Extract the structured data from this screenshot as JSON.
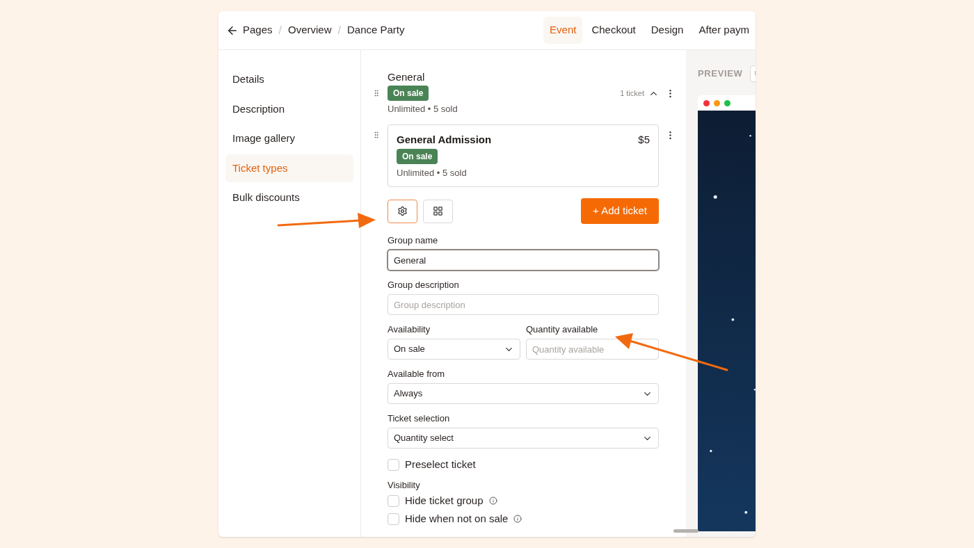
{
  "breadcrumb": {
    "items": [
      "Pages",
      "Overview",
      "Dance Party"
    ],
    "separator": "/"
  },
  "tabs": [
    {
      "label": "Event",
      "selected": true
    },
    {
      "label": "Checkout",
      "selected": false
    },
    {
      "label": "Design",
      "selected": false
    },
    {
      "label": "After paym",
      "selected": false
    }
  ],
  "sidebar": {
    "items": [
      {
        "label": "Details",
        "selected": false
      },
      {
        "label": "Description",
        "selected": false
      },
      {
        "label": "Image gallery",
        "selected": false
      },
      {
        "label": "Ticket types",
        "selected": true
      },
      {
        "label": "Bulk discounts",
        "selected": false
      }
    ]
  },
  "group": {
    "name": "General",
    "status": "On sale",
    "summary": "Unlimited • 5 sold",
    "count": "1 ticket",
    "expanded": true
  },
  "ticket": {
    "name": "General Admission",
    "price": "$5",
    "status": "On sale",
    "summary": "Unlimited • 5 sold"
  },
  "tool_buttons": [
    {
      "kind": "settings",
      "selected": true
    },
    {
      "kind": "grid",
      "selected": false
    }
  ],
  "add_button": "+ Add ticket",
  "form": {
    "rows": [
      [
        {
          "kind": "input",
          "label": "Group name",
          "value": "General",
          "focused": true
        }
      ],
      [
        {
          "kind": "input",
          "label": "Group description",
          "placeholder": "Group description",
          "focused": false
        }
      ],
      [
        {
          "kind": "select",
          "label": "Availability",
          "value": "On sale"
        },
        {
          "kind": "input",
          "label": "Quantity available",
          "placeholder": "Quantity available",
          "focused": false
        }
      ],
      [
        {
          "kind": "select",
          "label": "Available from",
          "value": "Always"
        }
      ],
      [
        {
          "kind": "select",
          "label": "Ticket selection",
          "value": "Quantity select"
        }
      ]
    ],
    "preselect": {
      "label": "Preselect ticket",
      "checked": false
    },
    "visibility": {
      "label": "Visibility",
      "options": [
        {
          "label": "Hide ticket group",
          "checked": false
        },
        {
          "label": "Hide when not on sale",
          "checked": false
        }
      ]
    }
  },
  "preview": {
    "label": "PREVIEW"
  }
}
